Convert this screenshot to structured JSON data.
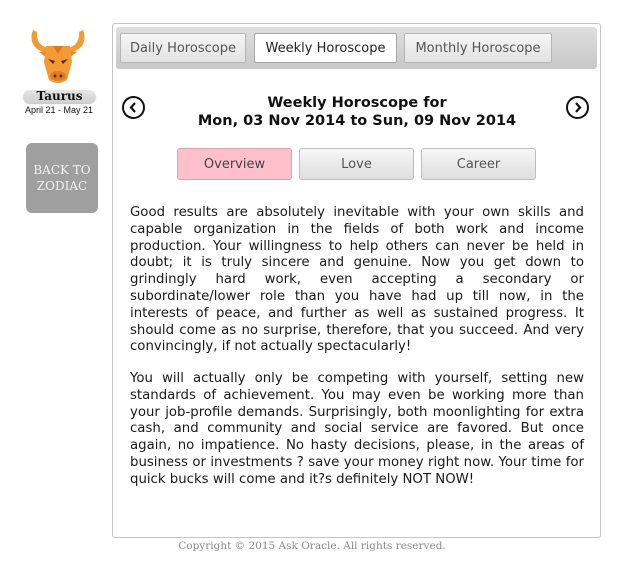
{
  "sign": {
    "name": "Taurus",
    "dates": "April 21 - May 21",
    "icon": "taurus-bull-icon",
    "icon_color": "#f29a35"
  },
  "back_button": {
    "label": "BACK TO ZODIAC"
  },
  "tabs": [
    {
      "label": "Daily Horoscope",
      "active": false
    },
    {
      "label": "Weekly Horoscope",
      "active": true
    },
    {
      "label": "Monthly Horoscope",
      "active": false
    }
  ],
  "heading": {
    "line1": "Weekly Horoscope for",
    "line2": "Mon, 03 Nov 2014 to Sun, 09 Nov 2014"
  },
  "navigation": {
    "prev_icon": "chevron-left-icon",
    "next_icon": "chevron-right-icon"
  },
  "subtabs": [
    {
      "label": "Overview",
      "active": true
    },
    {
      "label": "Love",
      "active": false
    },
    {
      "label": "Career",
      "active": false
    }
  ],
  "colors": {
    "active_subtab": "#ffc0cb",
    "back_button": "#9f9f9f"
  },
  "content": {
    "paragraphs": [
      "Good results are absolutely inevitable with your own skills and capable organization in the fields of both work and income production. Your willingness to help others can never be held in doubt; it is truly sincere and genuine. Now you get down to grindingly hard work, even accepting a secondary or subordinate/lower role than you have had up till now, in the interests of peace, and further as well as sustained progress. It should come as no surprise, therefore, that you succeed. And very convincingly, if not actually spectacularly!",
      "You will actually only be competing with yourself, setting new standards of achievement. You may even be working more than your job-profile demands. Surprisingly, both moonlighting for extra cash, and community and social service are favored. But once again, no impatience. No hasty decisions, please, in the areas of business or investments ? save your money right now. Your time for quick bucks will come and it?s definitely NOT NOW!"
    ]
  },
  "footer": {
    "copyright": "Copyright © 2015 Ask Oracle. All rights reserved."
  }
}
